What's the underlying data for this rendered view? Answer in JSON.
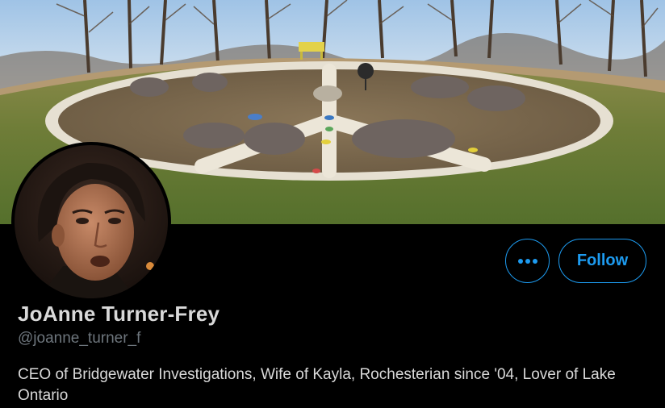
{
  "banner": {
    "description_icon": "peace-sign-garden-photo"
  },
  "avatar": {
    "icon": "profile-photo"
  },
  "actions": {
    "more_icon": "more-horizontal-icon",
    "follow_label": "Follow"
  },
  "profile": {
    "display_name": "JoAnne Turner-Frey",
    "handle": "@joanne_turner_f",
    "bio": "CEO of Bridgewater Investigations, Wife of Kayla, Rochesterian since '04, Lover of Lake Ontario"
  },
  "colors": {
    "accent": "#1d9bf0",
    "background": "#000000",
    "primary_text": "#d9d9d9",
    "secondary_text": "#6e767d"
  }
}
